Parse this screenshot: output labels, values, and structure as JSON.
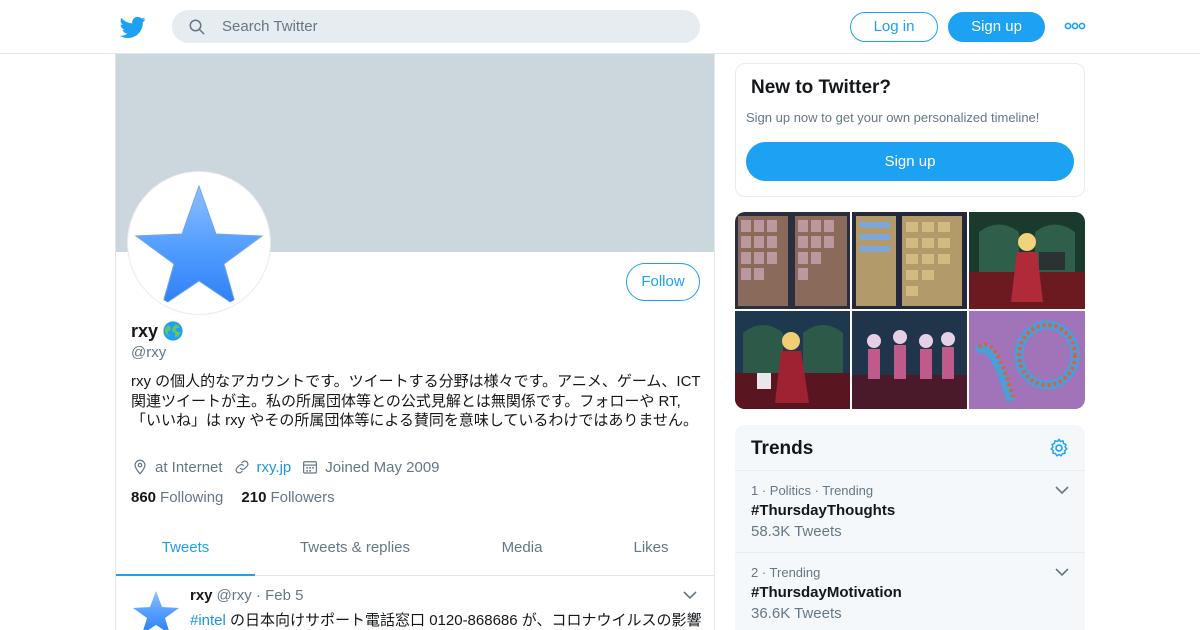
{
  "colors": {
    "accent": "#1da1f2",
    "link": "#1b95e0",
    "muted": "#657786",
    "banner": "#ccd6dd"
  },
  "header": {
    "logo_icon": "twitter-bird-icon",
    "search_placeholder": "Search Twitter",
    "login_label": "Log in",
    "signup_label": "Sign up",
    "more_icon": "more-dots-icon"
  },
  "profile": {
    "follow_label": "Follow",
    "name": "rxy",
    "name_badge_icon": "globe-icon",
    "handle": "@rxy",
    "bio": "rxy の個人的なアカウントです。ツイートする分野は様々です。アニメ、ゲーム、ICT 関連ツイートが主。私の所属団体等との公式見解とは無関係です。フォローや RT,「いいね」は rxy やその所属団体等による賛同を意味しているわけではありません。",
    "location": "at Internet",
    "url": "rxy.jp",
    "joined": "Joined May 2009",
    "following_count": "860",
    "following_label": "Following",
    "followers_count": "210",
    "followers_label": "Followers"
  },
  "tabs": [
    {
      "label": "Tweets",
      "active": true
    },
    {
      "label": "Tweets & replies",
      "active": false
    },
    {
      "label": "Media",
      "active": false
    },
    {
      "label": "Likes",
      "active": false
    }
  ],
  "tweet": {
    "name": "rxy",
    "handle": "@rxy",
    "separator": "·",
    "date": "Feb 5",
    "hashtag": "#intel",
    "text": " の日本向けサポート電話窓口 0120-868686 が、コロナウイルスの影響"
  },
  "new_to_twitter": {
    "title": "New to Twitter?",
    "subtitle": "Sign up now to get your own personalized timeline!",
    "signup_label": "Sign up"
  },
  "trends": {
    "title": "Trends",
    "items": [
      {
        "context": "1 · Politics · Trending",
        "name": "#ThursdayThoughts",
        "count": "58.3K Tweets"
      },
      {
        "context": "2 · Trending",
        "name": "#ThursdayMotivation",
        "count": "36.6K Tweets"
      }
    ]
  }
}
